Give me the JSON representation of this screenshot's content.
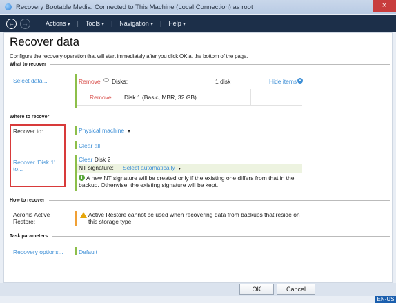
{
  "window": {
    "title": "Recovery Bootable Media: Connected to This Machine (Local Connection) as root",
    "close_glyph": "×"
  },
  "menubar": {
    "back_glyph": "←",
    "forward_glyph": "→",
    "items": [
      {
        "label": "Actions"
      },
      {
        "label": "Tools"
      },
      {
        "label": "Navigation"
      },
      {
        "label": "Help"
      }
    ],
    "separator": "|",
    "caret": "▾"
  },
  "page": {
    "title": "Recover data",
    "description": "Configure the recovery operation that will start immediately after you click OK at the bottom of the page."
  },
  "what_to_recover": {
    "section_label": "What to recover",
    "select_data_link": "Select data...",
    "remove_label": "Remove",
    "disks_label": "Disks:",
    "disk_count": "1 disk",
    "hide_items_link": "Hide items",
    "row_remove": "Remove",
    "row_disk": "Disk 1 (Basic, MBR, 32 GB)"
  },
  "where_to_recover": {
    "section_label": "Where to recover",
    "recover_to_label": "Recover to:",
    "recover_to_value": "Physical machine",
    "clear_all_link": "Clear all",
    "recover_disk_link": "Recover 'Disk 1' to...",
    "clear_link": "Clear",
    "target_disk": "Disk 2",
    "nt_signature_label": "NT signature:",
    "nt_signature_value": "Select automatically",
    "info_text": "A new NT signature will be created only if the existing one differs from that in the backup. Otherwise, the existing signature will be kept."
  },
  "how_to_recover": {
    "section_label": "How to recover",
    "aar_label": "Acronis Active Restore:",
    "aar_text": "Active Restore cannot be used when recovering data from backups that reside on this storage type."
  },
  "task_parameters": {
    "section_label": "Task parameters",
    "recovery_options_link": "Recovery options...",
    "default_link": "Default"
  },
  "buttons": {
    "ok": "OK",
    "cancel": "Cancel"
  },
  "status": {
    "language": "EN-US"
  },
  "colors": {
    "accent_link": "#3e8fd6",
    "menubar_bg": "#1c2f49",
    "highlight_border": "#d83a3a",
    "green_bar": "#8dbf4a",
    "remove_link": "#d9534f"
  }
}
